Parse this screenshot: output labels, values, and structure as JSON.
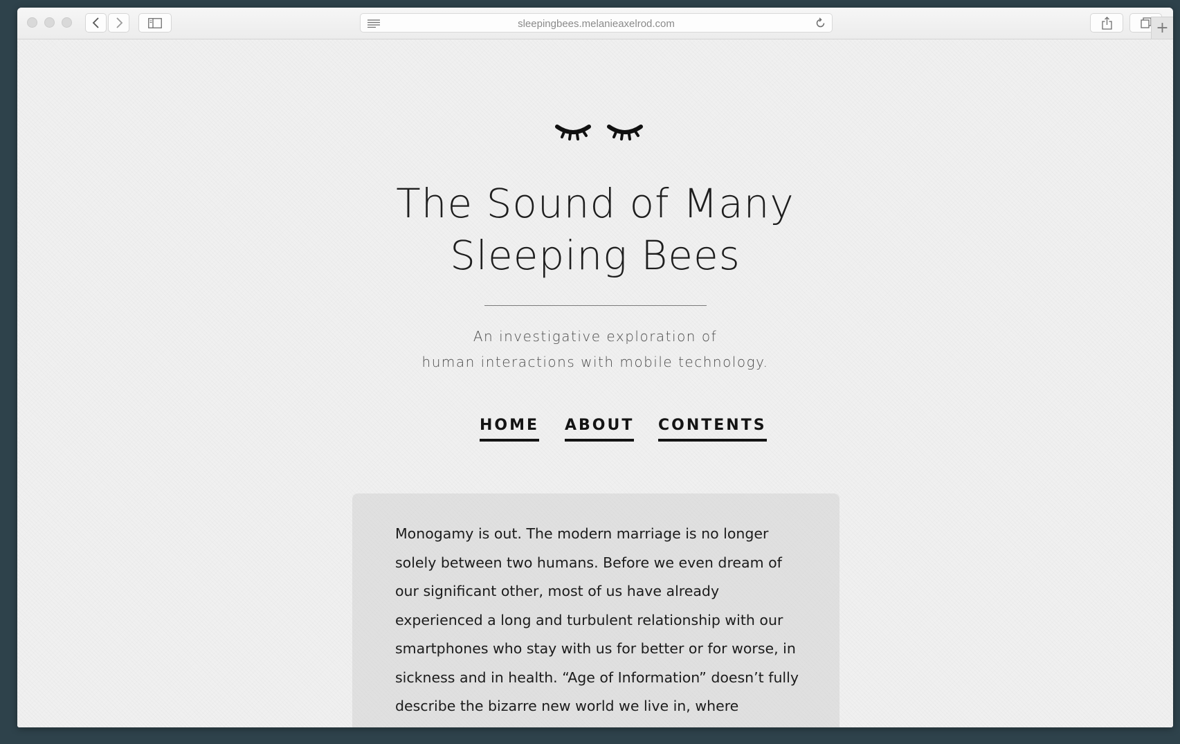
{
  "browser": {
    "url": "sleepingbees.melanieaxelrod.com",
    "new_tab_label": "+"
  },
  "site": {
    "logo_icon": "closed-eyes-icon",
    "title_line1": "The Sound of Many",
    "title_line2": "Sleeping Bees",
    "tagline_line1": "An investigative exploration of",
    "tagline_line2": "human interactions with mobile technology."
  },
  "nav": {
    "items": [
      {
        "label": "HOME"
      },
      {
        "label": "ABOUT"
      },
      {
        "label": "CONTENTS"
      }
    ]
  },
  "article": {
    "intro": "Monogamy is out. The modern marriage is no longer solely between two humans. Before we even dream of our significant other, most of us have already experienced a long and turbulent relationship with our smartphones who stay with us for better or for worse, in sickness and in health. “Age of Information” doesn’t fully describe the bizarre new world we live in, where"
  }
}
